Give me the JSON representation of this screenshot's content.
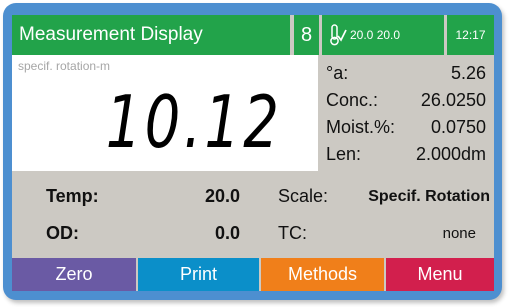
{
  "header": {
    "title": "Measurement Display",
    "mode_digit": "8",
    "status_icon": "thermometer-check-icon",
    "temp_readout": "20.0  20.0",
    "time": "12:17"
  },
  "display": {
    "unit_label": "specif. rotation-m",
    "main_value": "10.12"
  },
  "params": [
    {
      "label": "°a:",
      "value": "5.26"
    },
    {
      "label": "Conc.:",
      "value": "26.0250"
    },
    {
      "label": "Moist.%:",
      "value": "0.0750"
    },
    {
      "label": "Len:",
      "value": "2.000dm"
    }
  ],
  "info": {
    "temp_label": "Temp:",
    "temp_value": "20.0",
    "od_label": "OD:",
    "od_value": "0.0",
    "scale_label": "Scale:",
    "scale_value": "Specif. Rotation",
    "tc_label": "TC:",
    "tc_value": "none"
  },
  "buttons": [
    {
      "label": "Zero",
      "color": "#6a5aa4"
    },
    {
      "label": "Print",
      "color": "#0b8fc9"
    },
    {
      "label": "Methods",
      "color": "#f07f1a"
    },
    {
      "label": "Menu",
      "color": "#d21f4d"
    }
  ],
  "colors": {
    "header_green": "#22a34a",
    "frame_blue": "#4d8fd0",
    "panel_gray": "#ccc9c3"
  }
}
